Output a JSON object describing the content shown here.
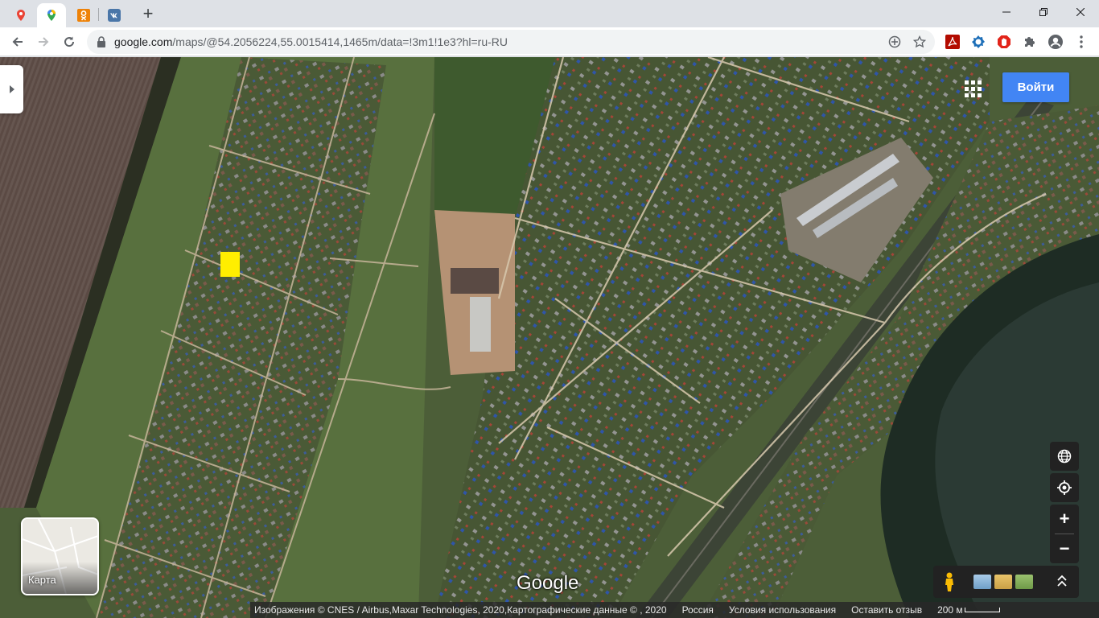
{
  "browser": {
    "tabs": [
      {
        "icon": "google-maps-pin-icon",
        "color": "#ea4335"
      },
      {
        "icon": "google-maps-icon",
        "color": "#34a853",
        "active": true
      },
      {
        "icon": "odnoklassniki-icon",
        "color": "#ee8208"
      },
      {
        "icon": "vk-icon",
        "color": "#4a76a8"
      }
    ],
    "new_tab_label": "+",
    "url_host": "google.com",
    "url_path": "/maps/@54.2056224,55.0015414,1465m/data=!3m1!1e3?hl=ru-RU",
    "extensions": [
      "acrobat-icon",
      "vpn-icon",
      "adblock-icon",
      "puzzle-icon",
      "profile-icon"
    ]
  },
  "map": {
    "signin_label": "Войти",
    "minimap_label": "Карта",
    "logo_text": "Google",
    "attribution": {
      "imagery": "Изображения © CNES / Airbus,Maxar Technologies, 2020,Картографические данные © , 2020",
      "country": "Россия",
      "terms": "Условия использования",
      "feedback": "Оставить отзыв",
      "scale": "200 м"
    },
    "controls": {
      "zoom_in": "+",
      "zoom_out": "−",
      "expand": "^"
    },
    "colors": {
      "signin": "#4285f4",
      "marker": "#ffee00"
    }
  }
}
